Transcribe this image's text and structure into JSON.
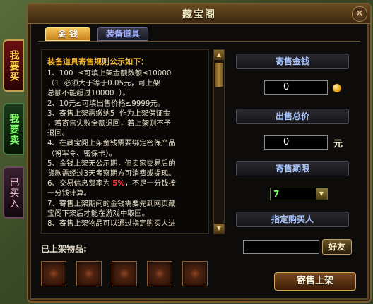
{
  "window": {
    "title": "藏宝阁",
    "close_label": "✕"
  },
  "tabs": {
    "money": "金 钱",
    "gear": "装备道具"
  },
  "side_tabs": {
    "buy": {
      "label": "我要买"
    },
    "sell": {
      "label": "我要卖"
    },
    "bought": {
      "label": "已买入"
    }
  },
  "rules": {
    "heading": "装备道具寄售规则公示如下：",
    "lines": [
      "1、100  ≤可填上架金额数额≤10000",
      "（1  必须大于等于0.05元，可上架",
      "总额不能超过10000  ）。",
      "2、10元≤可填出售价格≤9999元。",
      "3、寄售上架需缴纳5  作为上架保证金",
      "，若寄售失败全额退回，若上架则不予",
      "退回。",
      "4、在藏宝阁上架金钱需要绑定密保产品",
      "（将军令、密保卡）。",
      "5、金钱上架无公示期，但卖家交易后的",
      "货款需经过3天考察期方可消费或提现。",
      "6、交易信息费率为",
      "一分钱计算。",
      "7、寄售上架期间的金钱需要先到网页藏",
      "宝阁下架后才能在游戏中取回。",
      "8、寄售上架物品可以通过指定购买人进"
    ],
    "fee_rate": "5%",
    "fee_suffix": "，不足一分钱按"
  },
  "listed": {
    "label": "已上架物品:"
  },
  "form": {
    "money_title": "寄售金钱",
    "money_value": "0",
    "price_title": "出售总价",
    "price_value": "0",
    "price_unit": "元",
    "period_title": "寄售期限",
    "period_value": "7",
    "buyer_title": "指定购买人",
    "buyer_value": "",
    "friend_button": "好友",
    "submit_button": "寄售上架"
  }
}
